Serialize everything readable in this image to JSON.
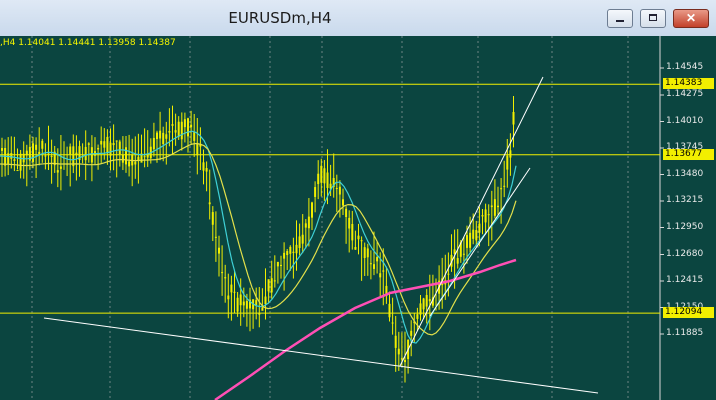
{
  "window": {
    "title": "EURUSDm,H4",
    "buttons": {
      "minimize": "minimize",
      "maximize": "maximize",
      "close": "✕"
    }
  },
  "chart": {
    "info_line": ",H4  1.14041 1.14441 1.13958 1.14387",
    "price_axis": [
      "1.14545",
      "1.14275",
      "1.14010",
      "1.13745",
      "1.13480",
      "1.13215",
      "1.12950",
      "1.12680",
      "1.12415",
      "1.12150",
      "1.11885"
    ],
    "horizontal_lines": [
      "1.14383",
      "1.13677",
      "1.12094"
    ],
    "colors": {
      "background": "#0b4540",
      "candles": "#f2ef00",
      "grid": "#b0b0b0",
      "ma_fast": "#3fd0d6",
      "ma_slow": "#e3e04a",
      "ma_long": "#ff4fb5",
      "trendline": "#ffffff",
      "hline": "#f2ef00"
    }
  }
}
